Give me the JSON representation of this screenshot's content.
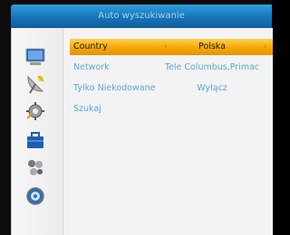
{
  "header": {
    "title": "Auto wyszukiwanie"
  },
  "sidebar": {
    "icons": [
      "tv-icon",
      "satellite-dish-icon",
      "settings-gear-icon",
      "toolbox-icon",
      "games-icon",
      "info-disc-icon"
    ]
  },
  "menu": {
    "items": [
      {
        "label": "Country",
        "value": "Polska",
        "selected": true
      },
      {
        "label": "Network",
        "value": "Tele Columbus,Primac",
        "selected": false
      },
      {
        "label": "Tylko Niekodowane",
        "value": "Wyłącz",
        "selected": false
      },
      {
        "label": "Szukaj",
        "value": "",
        "selected": false
      }
    ],
    "arrow_left": "‹",
    "arrow_right": "›"
  },
  "colors": {
    "header_blue": "#1774b8",
    "selected_orange": "#f5a300",
    "label_blue": "#5aa7d6"
  }
}
